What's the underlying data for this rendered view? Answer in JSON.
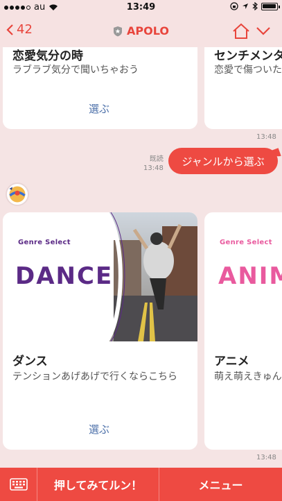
{
  "status": {
    "carrier": "au",
    "time": "13:49"
  },
  "header": {
    "back_count": "42",
    "title": "APOLO"
  },
  "cards_top": [
    {
      "title": "恋愛気分の時",
      "desc": "ラブラブ気分で聞いちゃおう",
      "choose": "選ぶ"
    },
    {
      "title": "センチメンタ",
      "desc": "恋愛で傷ついた"
    }
  ],
  "times": {
    "t1": "13:48",
    "t2": "13:48",
    "t3": "13:48"
  },
  "message": {
    "read_label": "既読",
    "text": "ジャンルから選ぶ"
  },
  "cards_genre": [
    {
      "label": "Genre Select",
      "word": "DANCE",
      "title": "ダンス",
      "desc": "テンションあげあげで行くならこちら",
      "choose": "選ぶ",
      "color": "#5b2a86"
    },
    {
      "label": "Genre Select",
      "word": "ANIM",
      "title": "アニメ",
      "desc": "萌え萌えきゅん",
      "color": "#e95a9e"
    }
  ],
  "bottom": {
    "push_label": "押してみてルン！",
    "menu_label": "メニュー"
  },
  "colors": {
    "accent": "#ee4a42",
    "link": "#4a6ea8",
    "bg": "#f5e4e4"
  }
}
